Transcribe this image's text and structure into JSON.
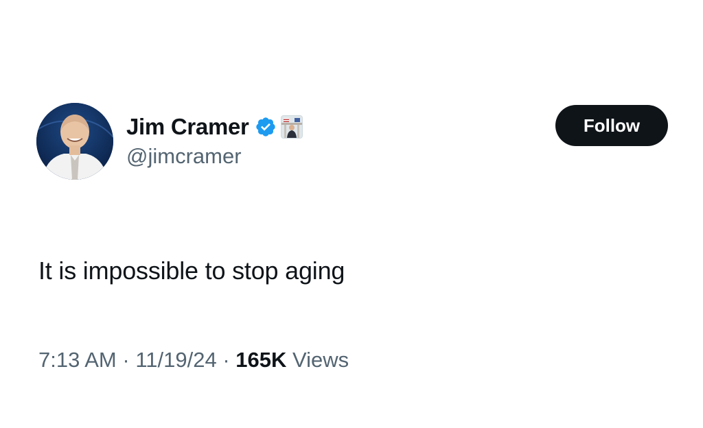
{
  "author": {
    "display_name": "Jim Cramer",
    "handle": "@jimcramer",
    "verified_icon": "verified-badge-icon",
    "affiliate_icon": "affiliate-badge-icon"
  },
  "actions": {
    "follow_label": "Follow"
  },
  "post": {
    "text": "It is impossible to stop aging",
    "time": "7:13 AM",
    "separator": "·",
    "date": "11/19/24",
    "views_count": "165K",
    "views_label": "Views"
  },
  "colors": {
    "text_primary": "#0f1419",
    "text_secondary": "#536471",
    "verified_blue": "#1d9bf0",
    "button_bg": "#0f1419"
  }
}
